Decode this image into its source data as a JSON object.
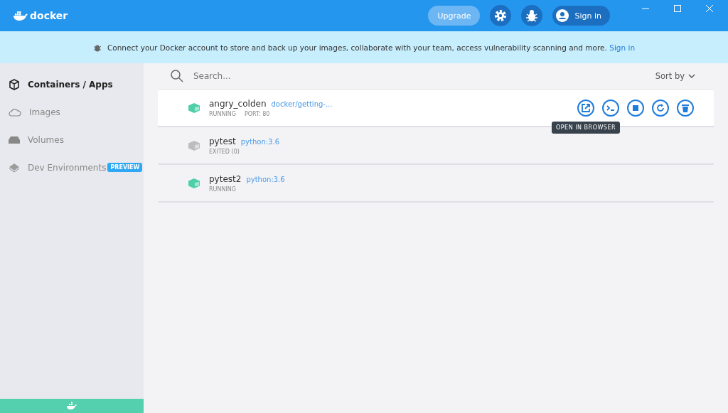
{
  "window": {
    "brand": "docker"
  },
  "header": {
    "upgrade": "Upgrade",
    "sign_in": "Sign in"
  },
  "banner": {
    "text": "Connect your Docker account to store and back up your images, collaborate with your team, access vulnerability scanning and more.",
    "link": "Sign in"
  },
  "sidebar": {
    "items": [
      {
        "label": "Containers / Apps",
        "selected": true
      },
      {
        "label": "Images",
        "selected": false
      },
      {
        "label": "Volumes",
        "selected": false
      },
      {
        "label": "Dev Environments",
        "selected": false,
        "badge": "PREVIEW"
      }
    ]
  },
  "search": {
    "placeholder": "Search..."
  },
  "sort": {
    "label": "Sort by"
  },
  "containers": [
    {
      "name": "angry_colden",
      "image": "docker/getting-...",
      "status": "RUNNING",
      "port": "PORT: 80",
      "running": true,
      "selected": true
    },
    {
      "name": "pytest",
      "image": "python:3.6",
      "status": "EXITED (0)",
      "running": false,
      "selected": false
    },
    {
      "name": "pytest2",
      "image": "python:3.6",
      "status": "RUNNING",
      "running": true,
      "selected": false
    }
  ],
  "actions": [
    {
      "kind": "open"
    },
    {
      "kind": "cli"
    },
    {
      "kind": "stop"
    },
    {
      "kind": "restart"
    },
    {
      "kind": "delete"
    }
  ],
  "tooltip": "OPEN IN BROWSER"
}
